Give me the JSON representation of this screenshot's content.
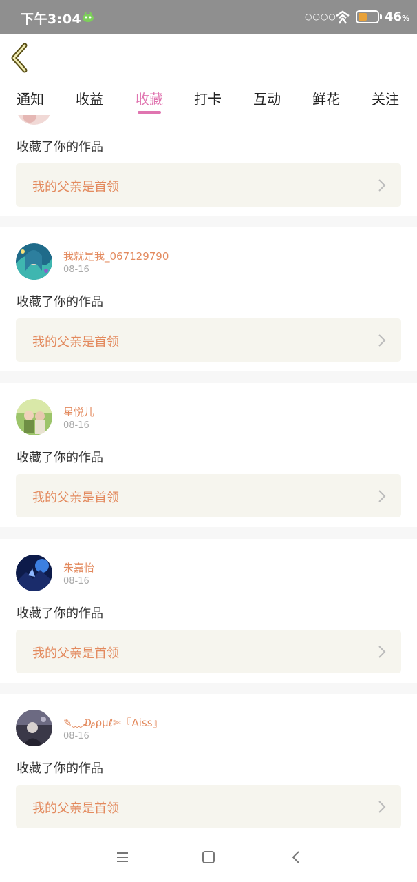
{
  "status_bar": {
    "time": "下午3:04",
    "signal": "○○○○",
    "battery_percent": "46",
    "battery_unit": "%",
    "battery_level": 0.46,
    "battery_color": "#e8a23a"
  },
  "nav": {
    "back_icon": "chevron-left-icon"
  },
  "tabs": [
    {
      "label": "通知",
      "active": false
    },
    {
      "label": "收益",
      "active": false
    },
    {
      "label": "收藏",
      "active": true
    },
    {
      "label": "打卡",
      "active": false
    },
    {
      "label": "互动",
      "active": false
    },
    {
      "label": "鲜花",
      "active": false
    },
    {
      "label": "关注",
      "active": false
    }
  ],
  "accent_color": "#e075b0",
  "feed": {
    "items": [
      {
        "user": "",
        "date": "",
        "action": "收藏了你的作品",
        "work_title": "我的父亲是首领"
      },
      {
        "user": "我就是我_067129790",
        "date": "08-16",
        "action": "收藏了你的作品",
        "work_title": "我的父亲是首领"
      },
      {
        "user": "星悦儿",
        "date": "08-16",
        "action": "收藏了你的作品",
        "work_title": "我的父亲是首领"
      },
      {
        "user": "朱嘉怡",
        "date": "08-16",
        "action": "收藏了你的作品",
        "work_title": "我的父亲是首领"
      },
      {
        "user": "✎﹏₯ρμℓ✄『Aiss』",
        "date": "08-16",
        "action": "收藏了你的作品",
        "work_title": "我的父亲是首领"
      }
    ]
  },
  "system_nav": {
    "menu_icon": "menu-icon",
    "home_icon": "home-square-icon",
    "back_icon": "back-triangle-icon"
  }
}
